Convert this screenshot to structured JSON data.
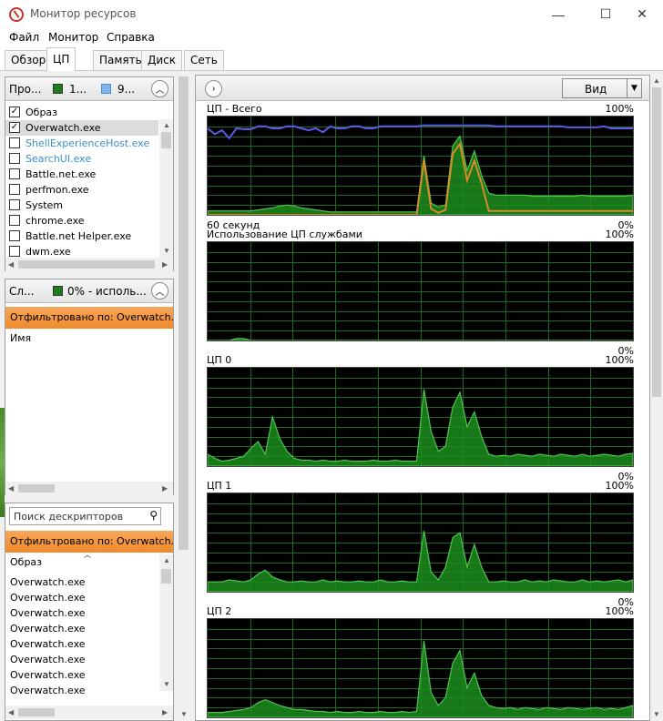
{
  "window": {
    "title": "Монитор ресурсов",
    "minimize": "—",
    "maximize": "☐",
    "close": "✕"
  },
  "menu": [
    "Файл",
    "Монитор",
    "Справка"
  ],
  "tabs": [
    "Обзор",
    "ЦП",
    "Память",
    "Диск",
    "Сеть"
  ],
  "active_tab": "ЦП",
  "processes": {
    "header_label": "Про...",
    "header_metric_1": "1...",
    "header_metric_2": "9...",
    "column_image": "Образ",
    "items": [
      {
        "name": "Overwatch.exe",
        "checked": true,
        "highlight": false
      },
      {
        "name": "ShellExperienceHost.exe",
        "checked": false,
        "highlight": true
      },
      {
        "name": "SearchUI.exe",
        "checked": false,
        "highlight": true
      },
      {
        "name": "Battle.net.exe",
        "checked": false,
        "highlight": false
      },
      {
        "name": "perfmon.exe",
        "checked": false,
        "highlight": false
      },
      {
        "name": "System",
        "checked": false,
        "highlight": false
      },
      {
        "name": "chrome.exe",
        "checked": false,
        "highlight": false
      },
      {
        "name": "Battle.net Helper.exe",
        "checked": false,
        "highlight": false
      },
      {
        "name": "dwm.exe",
        "checked": false,
        "highlight": false
      }
    ]
  },
  "services": {
    "header_label": "Сл...",
    "header_metric": "0% - исполь...",
    "filter": "Отфильтровано по: Overwatch...",
    "column_name": "Имя"
  },
  "handles": {
    "search_placeholder": "Поиск дескрипторов",
    "filter": "Отфильтровано по: Overwatch...",
    "column_image": "Образ",
    "items": [
      "Overwatch.exe",
      "Overwatch.exe",
      "Overwatch.exe",
      "Overwatch.exe",
      "Overwatch.exe",
      "Overwatch.exe",
      "Overwatch.exe",
      "Overwatch.exe"
    ]
  },
  "view_button": "Вид",
  "graphs": [
    {
      "title": "ЦП - Всего",
      "max": "100%",
      "footer_left": "60 секунд",
      "footer_right": "0%"
    },
    {
      "title": "Использование ЦП службами",
      "max": "100%",
      "footer_right": "0%"
    },
    {
      "title": "ЦП 0",
      "max": "100%",
      "footer_right": "0%"
    },
    {
      "title": "ЦП 1",
      "max": "100%",
      "footer_right": "0%"
    },
    {
      "title": "ЦП 2",
      "max": "100%"
    }
  ],
  "chart_data": [
    {
      "type": "area",
      "title": "ЦП - Всего",
      "ylim": [
        0,
        100
      ],
      "series": [
        {
          "values": [
            4,
            4,
            4,
            4,
            4,
            4,
            4,
            5,
            6,
            7,
            9,
            10,
            9,
            7,
            6,
            5,
            4,
            3,
            3,
            3,
            3,
            3,
            3,
            3,
            3,
            3,
            3,
            3,
            3,
            3,
            60,
            12,
            8,
            10,
            70,
            80,
            45,
            65,
            40,
            22,
            20,
            20,
            20,
            20,
            20,
            19,
            19,
            19,
            19,
            19,
            19,
            19,
            20,
            19,
            19,
            19,
            19,
            19,
            19,
            20
          ]
        },
        {
          "values": [
            0,
            0,
            0,
            0,
            0,
            0,
            0,
            0,
            0,
            0,
            0,
            0,
            0,
            0,
            0,
            0,
            0,
            0,
            0,
            0,
            0,
            0,
            0,
            0,
            0,
            0,
            0,
            0,
            0,
            0,
            55,
            6,
            2,
            5,
            62,
            72,
            35,
            55,
            32,
            4,
            4,
            4,
            4,
            4,
            4,
            4,
            4,
            4,
            4,
            4,
            4,
            4,
            4,
            4,
            4,
            4,
            4,
            4,
            4,
            4
          ]
        },
        {
          "values": [
            88,
            82,
            86,
            78,
            88,
            87,
            87,
            90,
            90,
            88,
            88,
            90,
            90,
            88,
            86,
            88,
            84,
            90,
            88,
            88,
            90,
            90,
            88,
            88,
            90,
            90,
            90,
            90,
            90,
            90,
            91,
            91,
            91,
            91,
            91,
            91,
            91,
            91,
            91,
            91,
            90,
            90,
            90,
            90,
            90,
            90,
            90,
            90,
            90,
            90,
            89,
            89,
            89,
            89,
            89,
            90,
            88,
            88,
            88,
            88
          ]
        }
      ],
      "colors": [
        "#4fc44f",
        "#d98a2b",
        "#5b5be6"
      ],
      "grid": true
    },
    {
      "type": "area",
      "title": "Использование ЦП службами",
      "ylim": [
        0,
        100
      ],
      "series": [
        {
          "values": [
            0,
            0,
            0,
            0,
            2,
            2,
            0,
            0,
            0,
            0,
            0,
            0,
            0,
            0,
            0,
            0,
            0,
            0,
            0,
            0,
            0,
            0,
            0,
            0,
            0,
            0,
            0,
            0,
            0,
            0,
            0,
            0,
            0,
            0,
            0,
            0,
            0,
            0,
            0,
            0,
            0,
            0,
            0,
            0,
            0,
            0,
            0,
            0,
            0,
            0,
            0,
            0,
            0,
            0,
            0,
            0,
            0,
            0,
            0,
            0
          ]
        }
      ],
      "colors": [
        "#4fc44f"
      ],
      "grid": true
    },
    {
      "type": "area",
      "title": "ЦП 0",
      "ylim": [
        0,
        100
      ],
      "series": [
        {
          "values": [
            12,
            8,
            5,
            6,
            8,
            10,
            18,
            25,
            12,
            50,
            28,
            15,
            8,
            6,
            6,
            5,
            6,
            5,
            5,
            6,
            5,
            5,
            5,
            6,
            5,
            5,
            6,
            5,
            5,
            5,
            78,
            35,
            15,
            20,
            60,
            75,
            40,
            55,
            30,
            12,
            10,
            11,
            10,
            12,
            11,
            10,
            12,
            11,
            10,
            12,
            11,
            10,
            12,
            10,
            11,
            12,
            11,
            10,
            12,
            13
          ]
        }
      ],
      "colors": [
        "#4fc44f"
      ],
      "grid": true
    },
    {
      "type": "area",
      "title": "ЦП 1",
      "ylim": [
        0,
        100
      ],
      "series": [
        {
          "values": [
            10,
            10,
            10,
            12,
            11,
            10,
            12,
            18,
            22,
            15,
            12,
            10,
            10,
            11,
            10,
            10,
            12,
            10,
            11,
            10,
            10,
            11,
            10,
            10,
            12,
            10,
            10,
            11,
            10,
            10,
            62,
            20,
            12,
            25,
            55,
            60,
            25,
            48,
            25,
            10,
            10,
            11,
            10,
            10,
            12,
            10,
            11,
            10,
            12,
            11,
            10,
            10,
            12,
            10,
            11,
            10,
            11,
            12,
            10,
            12
          ]
        }
      ],
      "colors": [
        "#4fc44f"
      ],
      "grid": true
    },
    {
      "type": "area",
      "title": "ЦП 2",
      "ylim": [
        0,
        100
      ],
      "series": [
        {
          "values": [
            5,
            5,
            5,
            6,
            7,
            8,
            10,
            15,
            18,
            15,
            12,
            10,
            8,
            8,
            7,
            6,
            6,
            5,
            6,
            5,
            5,
            6,
            5,
            5,
            6,
            5,
            5,
            6,
            5,
            6,
            78,
            25,
            12,
            20,
            55,
            68,
            30,
            45,
            22,
            12,
            10,
            9,
            10,
            8,
            10,
            9,
            8,
            10,
            9,
            8,
            10,
            9,
            8,
            9,
            10,
            8,
            9,
            8,
            10,
            12
          ]
        }
      ],
      "colors": [
        "#4fc44f"
      ],
      "grid": true
    }
  ]
}
